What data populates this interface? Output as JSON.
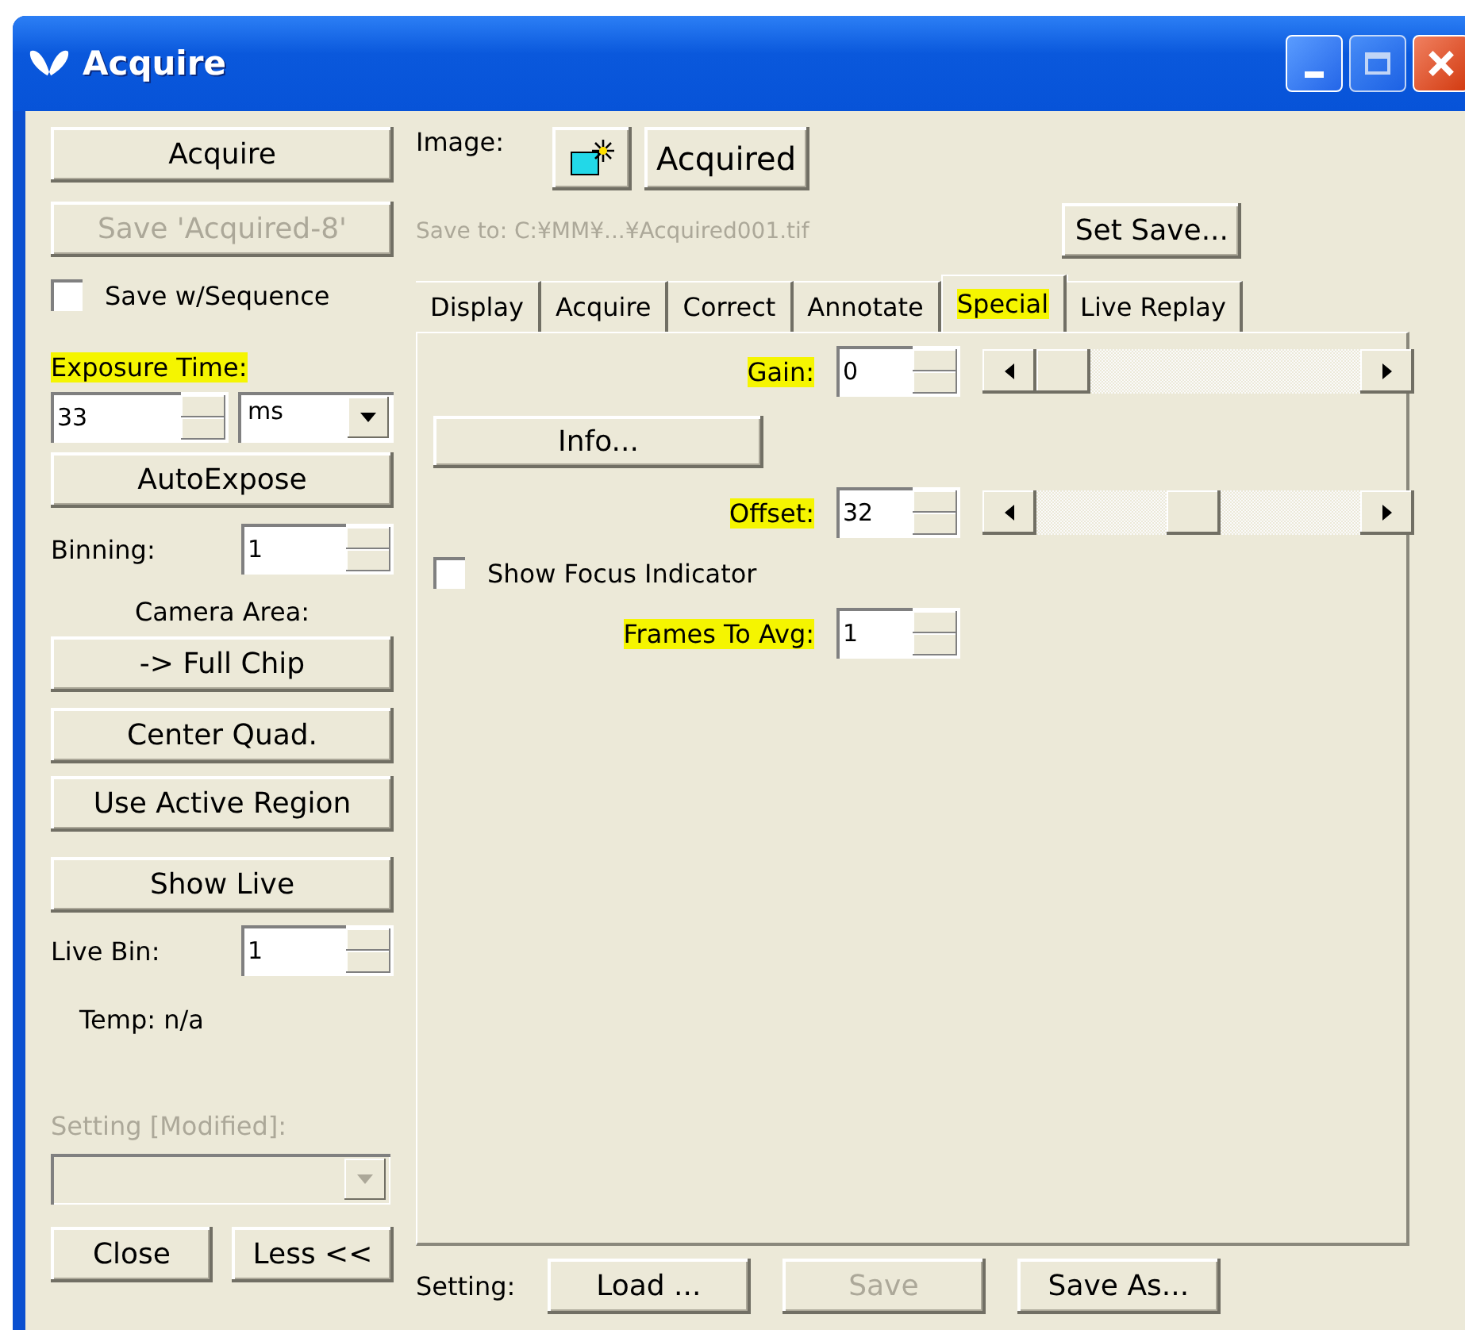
{
  "window": {
    "title": "Acquire"
  },
  "left": {
    "acquire_button": "Acquire",
    "save_button": {
      "label": "Save 'Acquired-8'",
      "disabled": true
    },
    "save_sequence": {
      "label": "Save w/Sequence",
      "checked": false
    },
    "exposure": {
      "label": "Exposure Time:",
      "highlighted": true,
      "value": "33",
      "unit": "ms"
    },
    "autoexpose_button": "AutoExpose",
    "binning": {
      "label": "Binning:",
      "value": "1"
    },
    "camera_area_label": "Camera Area:",
    "area_buttons": [
      "-> Full Chip",
      "Center Quad.",
      "Use Active Region"
    ],
    "show_live_button": "Show Live",
    "live_bin": {
      "label": "Live Bin:",
      "value": "1"
    },
    "temp": "Temp: n/a",
    "setting_select": {
      "label": "Setting [Modified]:",
      "disabled": true
    }
  },
  "image": {
    "label": "Image:",
    "name_button": "Acquired",
    "save_to": {
      "text": "Save to: C:¥MM¥...¥Acquired001.tif",
      "disabled": true
    },
    "set_save_button": "Set Save..."
  },
  "tabs": [
    {
      "label": "Display",
      "selected": false,
      "highlighted": false
    },
    {
      "label": "Acquire",
      "selected": false,
      "highlighted": false
    },
    {
      "label": "Correct",
      "selected": false,
      "highlighted": false
    },
    {
      "label": "Annotate",
      "selected": false,
      "highlighted": false
    },
    {
      "label": "Special",
      "selected": true,
      "highlighted": true
    },
    {
      "label": "Live Replay",
      "selected": false,
      "highlighted": false
    }
  ],
  "special": [
    {
      "kind": "slider",
      "label": "Gain:",
      "highlighted": true,
      "value": "0",
      "level": 0
    },
    {
      "kind": "button",
      "label": "Info..."
    },
    {
      "kind": "slider",
      "label": "Offset:",
      "highlighted": true,
      "value": "32",
      "level": 0.48
    },
    {
      "kind": "checkbox",
      "label": "Show Focus Indicator",
      "checked": false
    },
    {
      "kind": "spin",
      "label": "Frames To Avg:",
      "highlighted": true,
      "value": "1"
    }
  ],
  "bottom": {
    "close_button": "Close",
    "less_button": "Less <<",
    "setting_label": "Setting:",
    "buttons": [
      {
        "label": "Load ...",
        "disabled": false
      },
      {
        "label": "Save",
        "disabled": true
      },
      {
        "label": "Save As...",
        "disabled": false
      }
    ]
  }
}
